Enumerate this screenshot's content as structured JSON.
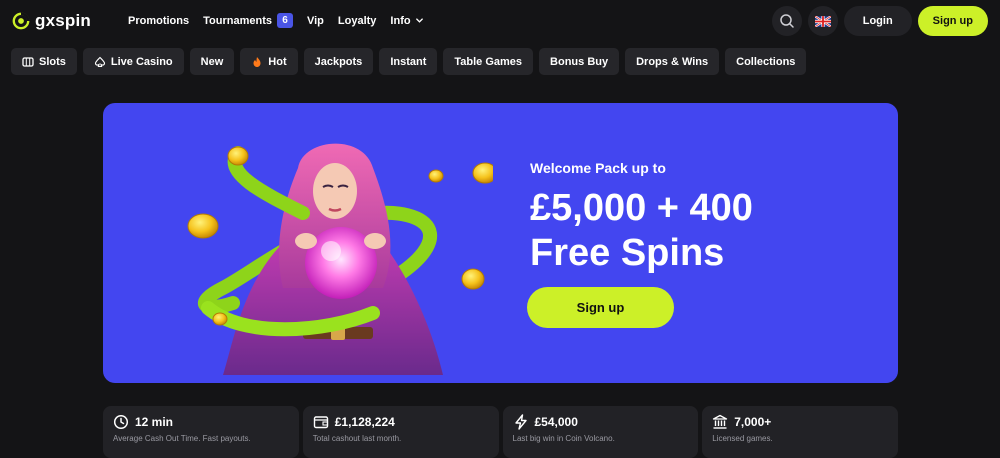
{
  "brand": {
    "name": "gxspin",
    "accent": "#ccf028",
    "hero_bg": "#4346f0"
  },
  "nav": {
    "promotions": "Promotions",
    "tournaments": "Tournaments",
    "tournaments_badge": "6",
    "vip": "Vip",
    "loyalty": "Loyalty",
    "info": "Info"
  },
  "header": {
    "search_icon": "search-icon",
    "language_icon": "uk-flag-icon",
    "login_label": "Login",
    "signup_label": "Sign up"
  },
  "categories": [
    {
      "label": "Slots",
      "icon": "slot-machine-icon"
    },
    {
      "label": "Live Casino",
      "icon": "spade-icon"
    },
    {
      "label": "New",
      "icon": ""
    },
    {
      "label": "Hot",
      "icon": "flame-icon"
    },
    {
      "label": "Jackpots",
      "icon": ""
    },
    {
      "label": "Instant",
      "icon": ""
    },
    {
      "label": "Table Games",
      "icon": ""
    },
    {
      "label": "Bonus Buy",
      "icon": ""
    },
    {
      "label": "Drops & Wins",
      "icon": ""
    },
    {
      "label": "Collections",
      "icon": ""
    }
  ],
  "hero": {
    "subtitle": "Welcome Pack up to",
    "title_line1": "£5,000 + 400",
    "title_line2": "Free Spins",
    "cta": "Sign up"
  },
  "stats": [
    {
      "value": "12 min",
      "desc": "Average Cash Out Time. Fast payouts.",
      "icon": "clock-icon"
    },
    {
      "value": "£1,128,224",
      "desc": "Total cashout last month.",
      "icon": "wallet-icon"
    },
    {
      "value": "£54,000",
      "desc": "Last big win in Coin Volcano.",
      "icon": "lightning-icon"
    },
    {
      "value": "7,000+",
      "desc": "Licensed games.",
      "icon": "building-icon"
    }
  ]
}
